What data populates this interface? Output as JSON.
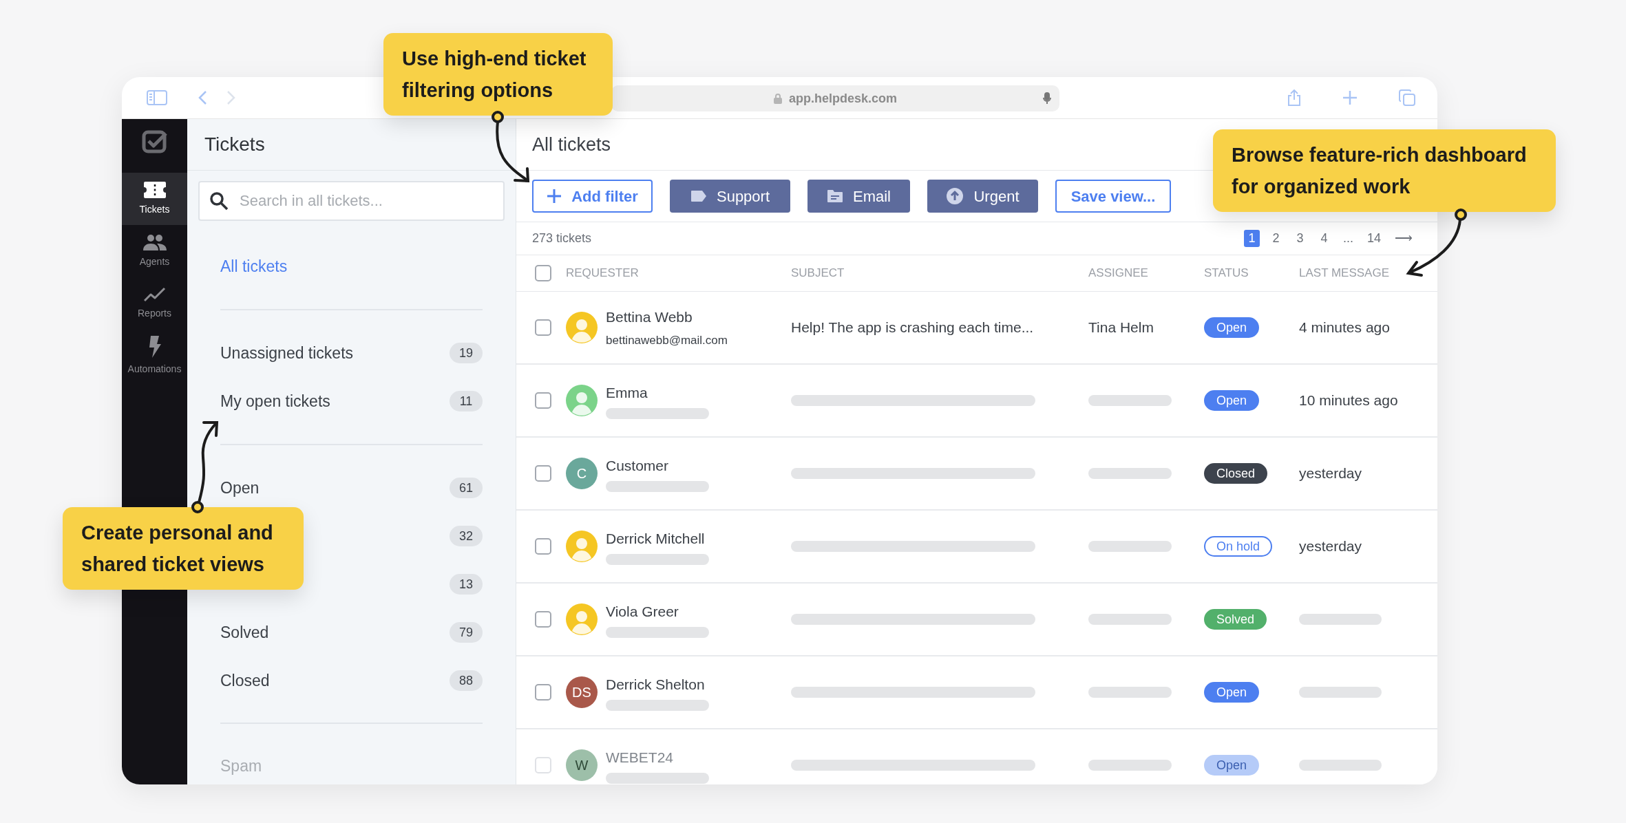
{
  "browser": {
    "url": "app.helpdesk.com"
  },
  "rail": [
    {
      "label": "Tickets",
      "kind": "ticket",
      "selected": true
    },
    {
      "label": "Agents",
      "kind": "people",
      "selected": false
    },
    {
      "label": "Reports",
      "kind": "chart",
      "selected": false
    },
    {
      "label": "Automations",
      "kind": "bolt",
      "selected": false
    }
  ],
  "sidebar": {
    "title": "Tickets",
    "search": {
      "placeholder": "Search in all tickets..."
    },
    "groups": [
      [
        {
          "label": "All tickets",
          "selected": true
        }
      ],
      [
        {
          "label": "Unassigned tickets",
          "count": "19",
          "selected": false
        },
        {
          "label": "My open tickets",
          "count": "11",
          "selected": false
        }
      ],
      [
        {
          "label": "Open",
          "count": "61",
          "selected": false
        },
        {
          "count": "32"
        },
        {
          "count": "13"
        },
        {
          "label": "Solved",
          "count": "79",
          "selected": false
        },
        {
          "label": "Closed",
          "count": "88",
          "selected": false
        }
      ],
      [
        {
          "label": "Spam",
          "muted": true,
          "selected": false
        }
      ]
    ]
  },
  "main": {
    "title": "All tickets",
    "filters": [
      {
        "kind": "add",
        "label": "Add filter"
      },
      {
        "kind": "tag",
        "label": "Support"
      },
      {
        "kind": "folder",
        "label": "Email"
      },
      {
        "kind": "priority",
        "label": "Urgent"
      },
      {
        "kind": "save",
        "label": "Save view..."
      }
    ],
    "total": "273 tickets",
    "pages": [
      {
        "label": "1",
        "selected": true
      },
      {
        "label": "2",
        "selected": false
      },
      {
        "label": "3",
        "selected": false
      },
      {
        "label": "4",
        "selected": false
      },
      {
        "label": "...",
        "selected": false
      },
      {
        "label": "14",
        "selected": false
      },
      {
        "label": "⟶",
        "selected": false
      }
    ],
    "table": {
      "select_all": {
        "checked": false
      },
      "columns": [
        "REQUESTER",
        "SUBJECT",
        "ASSIGNEE",
        "STATUS",
        "LAST MESSAGE"
      ],
      "rows": [
        {
          "checked": false,
          "disabled": false,
          "avatar": {
            "kind": "photo",
            "color": "#f5c623"
          },
          "name": "Bettina Webb",
          "email": "bettinawebb@mail.com",
          "subject": "Help! The app is crashing each time...",
          "assignee": "Tina Helm",
          "status": {
            "kind": "open",
            "label": "Open"
          },
          "last_message": "4 minutes ago"
        },
        {
          "checked": false,
          "disabled": false,
          "avatar": {
            "kind": "photo",
            "color": "#7bd389"
          },
          "name": "Emma",
          "status": {
            "kind": "open",
            "label": "Open"
          },
          "last_message": "10 minutes ago"
        },
        {
          "checked": false,
          "disabled": false,
          "avatar": {
            "kind": "initials",
            "text": "C",
            "color": "#6aa89b"
          },
          "name": "Customer",
          "status": {
            "kind": "closed",
            "label": "Closed"
          },
          "last_message": "yesterday"
        },
        {
          "checked": false,
          "disabled": false,
          "avatar": {
            "kind": "photo",
            "color": "#f5c623"
          },
          "name": "Derrick Mitchell",
          "status": {
            "kind": "on_hold",
            "label": "On hold"
          },
          "last_message": "yesterday"
        },
        {
          "checked": false,
          "disabled": false,
          "avatar": {
            "kind": "photo",
            "color": "#f5c623"
          },
          "name": "Viola Greer",
          "status": {
            "kind": "solved",
            "label": "Solved"
          }
        },
        {
          "checked": false,
          "disabled": false,
          "avatar": {
            "kind": "initials",
            "text": "DS",
            "color": "#a9584a"
          },
          "name": "Derrick Shelton",
          "status": {
            "kind": "open",
            "label": "Open"
          }
        },
        {
          "checked": false,
          "disabled": true,
          "avatar": {
            "kind": "initials",
            "text": "W",
            "color": "#9dbfa9"
          },
          "name": "WEBET24",
          "status": {
            "kind": "open",
            "label": "Open"
          }
        }
      ]
    }
  },
  "callouts": [
    {
      "lines": [
        "Use high-end ticket",
        "filtering options"
      ]
    },
    {
      "lines": [
        "Browse feature-rich dashboard",
        "for organized work"
      ]
    },
    {
      "lines": [
        "Create personal and",
        "shared ticket views"
      ]
    }
  ]
}
